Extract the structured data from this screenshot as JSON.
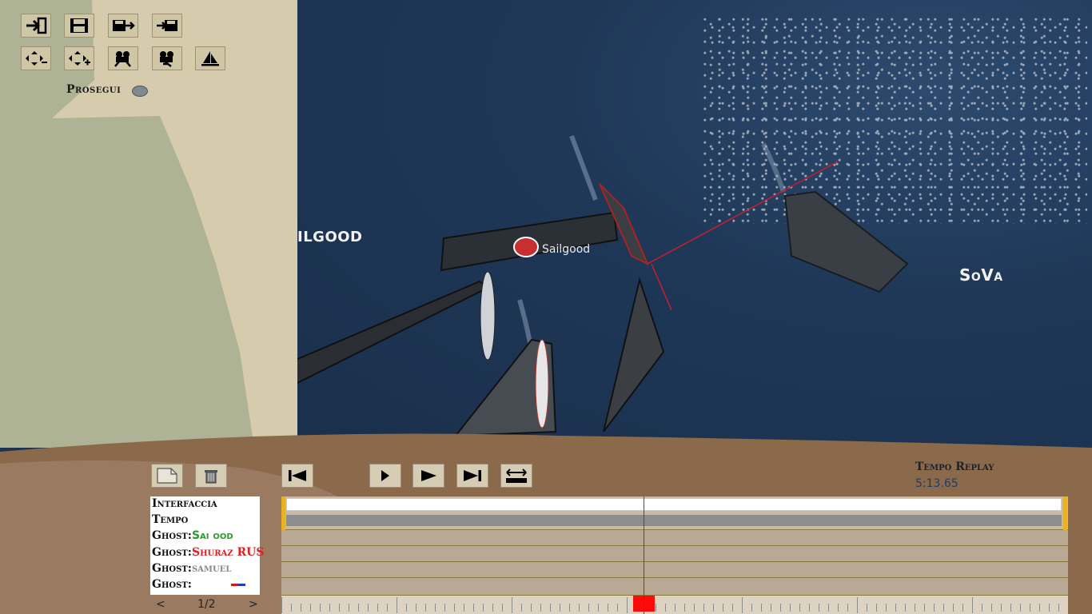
{
  "toolbar": {
    "row1": [
      {
        "id": "enter",
        "icon": "enter-arrow-icon"
      },
      {
        "id": "save",
        "icon": "floppy-disk-icon"
      },
      {
        "id": "save-export",
        "icon": "floppy-export-icon"
      },
      {
        "id": "load-import",
        "icon": "floppy-import-icon"
      }
    ],
    "row2": [
      {
        "id": "zoom-out",
        "icon": "zoom-out-arrows-icon"
      },
      {
        "id": "zoom-in",
        "icon": "zoom-in-arrows-icon"
      },
      {
        "id": "camera-1",
        "icon": "camera-icon"
      },
      {
        "id": "camera-2",
        "icon": "camera-follow-icon"
      },
      {
        "id": "boat",
        "icon": "sailboat-icon"
      }
    ],
    "prosegui_label": "Prosegui"
  },
  "scene": {
    "boat_labels": {
      "left": "ILGOOD",
      "right": "SoVa"
    },
    "sail_brand": "Sailgood"
  },
  "controls": {
    "left": [
      {
        "icon": "view-page-icon"
      },
      {
        "icon": "trash-can-icon"
      }
    ],
    "playback": [
      {
        "icon": "skip-to-start-icon"
      },
      {
        "icon": "play-slow-icon"
      },
      {
        "icon": "play-icon"
      },
      {
        "icon": "skip-to-end-icon"
      },
      {
        "icon": "loop-arrows-icon"
      }
    ]
  },
  "tempo_replay": {
    "title": "Tempo Replay",
    "value": "5:13.65"
  },
  "tracks": {
    "rows": [
      {
        "prefix": "Interfaccia",
        "name": ""
      },
      {
        "prefix": "Tempo",
        "name": ""
      },
      {
        "prefix": "Ghost:",
        "name": "Sai      ood",
        "name_colors": [
          "#2a9a2a",
          "#e76b6b"
        ]
      },
      {
        "prefix": "Ghost:",
        "name": "Shuraz RUS",
        "name_colors": [
          "#e02020",
          "#e0b020"
        ]
      },
      {
        "prefix": "Ghost:",
        "name": "samuel",
        "name_colors": [
          "#8a8a8a"
        ]
      },
      {
        "prefix": "Ghost:",
        "name": "",
        "flag_colors": [
          "#d01a1a",
          "#1a3ad0"
        ]
      }
    ],
    "pager": {
      "prev": "<",
      "page": "1/2",
      "next": ">"
    },
    "cursor_fraction": 0.46
  },
  "colors": {
    "sea": "#1f3858",
    "sand": "#d6ccad",
    "grass": "#aeb396",
    "shore": "#8b6a4b",
    "cursor": "#e01010"
  }
}
